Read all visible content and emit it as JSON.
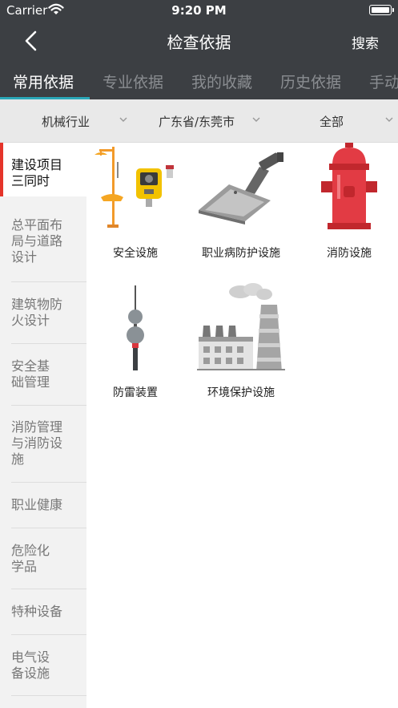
{
  "status": {
    "carrier": "Carrier",
    "time": "9:20 PM"
  },
  "nav": {
    "title": "检查依据",
    "search_label": "搜索"
  },
  "tabs": [
    "常用依据",
    "专业依据",
    "我的收藏",
    "历史依据",
    "手动"
  ],
  "filters": [
    "机械行业",
    "广东省/东莞市",
    "全部"
  ],
  "sidebar": [
    "建设项目\n三同时",
    "总平面布\n局与道路\n设计",
    "建筑物防\n火设计",
    "安全基\n础管理",
    "消防管理\n与消防设\n施",
    "职业健康",
    "危险化\n学品",
    "特种设备",
    "电气设\n备设施"
  ],
  "grid": [
    {
      "label": "安全设施",
      "icon": "safety-facility-icon"
    },
    {
      "label": "职业病防护设施",
      "icon": "dust-collector-icon"
    },
    {
      "label": "消防设施",
      "icon": "fire-hydrant-icon"
    },
    {
      "label": "防雷装置",
      "icon": "lightning-rod-icon"
    },
    {
      "label": "环境保护设施",
      "icon": "factory-icon"
    }
  ],
  "colors": {
    "header": "#3c3f43",
    "accent": "#2aa7b8",
    "active_marker": "#e5342a",
    "hydrant": "#e23b44"
  }
}
